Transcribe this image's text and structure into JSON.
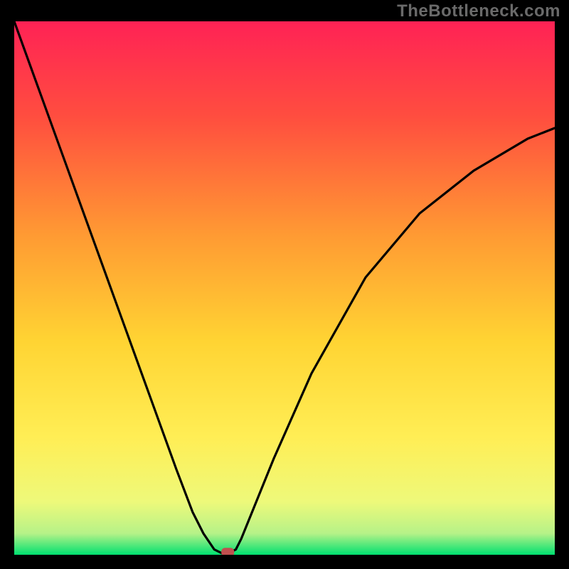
{
  "watermark": "TheBottleneck.com",
  "chart_data": {
    "type": "line",
    "title": "",
    "xlabel": "",
    "ylabel": "",
    "xlim": [
      0,
      100
    ],
    "ylim": [
      0,
      100
    ],
    "background_gradient": [
      "#ff2255",
      "#ffee33",
      "#00e070"
    ],
    "series": [
      {
        "name": "bottleneck-curve",
        "x": [
          0,
          5,
          10,
          15,
          20,
          25,
          30,
          33,
          35,
          37,
          39,
          41,
          42,
          44,
          48,
          55,
          65,
          75,
          85,
          95,
          100
        ],
        "y": [
          100,
          86,
          72,
          58,
          44,
          30,
          16,
          8,
          4,
          1,
          0,
          1,
          3,
          8,
          18,
          34,
          52,
          64,
          72,
          78,
          80
        ]
      }
    ],
    "marker": {
      "x": 39.5,
      "y": 0.5,
      "color": "#c0504f"
    },
    "grid": false,
    "legend": false
  }
}
